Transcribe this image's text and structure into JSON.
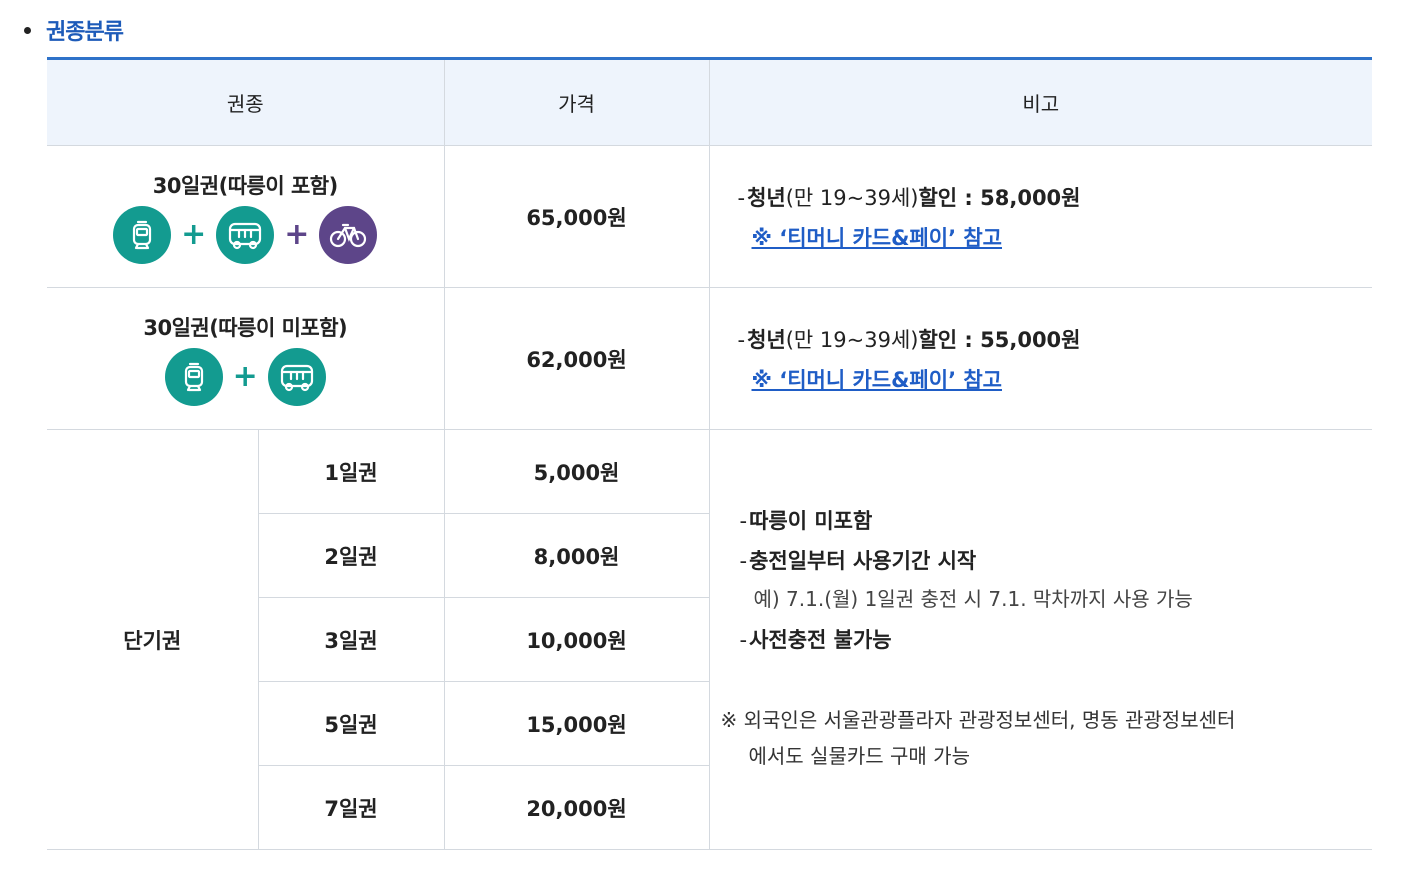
{
  "section": {
    "title": "권종분류"
  },
  "table": {
    "headers": [
      "권종",
      "가격",
      "비고"
    ],
    "monthly": [
      {
        "name": "30일권(따릉이 포함)",
        "icons": [
          "subway-icon",
          "bus-icon",
          "bicycle-icon"
        ],
        "price": "65,000원",
        "note_bold_a": "청년",
        "note_thin": "(만 19~39세)",
        "note_bold_b": "할인 : 58,000원",
        "note_link": "※ ‘티머니 카드&페이’ 참고"
      },
      {
        "name": "30일권(따릉이 미포함)",
        "icons": [
          "subway-icon",
          "bus-icon"
        ],
        "price": "62,000원",
        "note_bold_a": "청년",
        "note_thin": "(만 19~39세)",
        "note_bold_b": "할인 : 55,000원",
        "note_link": "※ ‘티머니 카드&페이’ 참고"
      }
    ],
    "short_term": {
      "label": "단기권",
      "rows": [
        {
          "name": "1일권",
          "price": "5,000원"
        },
        {
          "name": "2일권",
          "price": "8,000원"
        },
        {
          "name": "3일권",
          "price": "10,000원"
        },
        {
          "name": "5일권",
          "price": "15,000원"
        },
        {
          "name": "7일권",
          "price": "20,000원"
        }
      ],
      "notes": {
        "item1": "따릉이 미포함",
        "item2": "충전일부터 사용기간 시작",
        "item2_sub": "예) 7.1.(월) 1일권 충전 시 7.1. 막차까지 사용 가능",
        "item3": "사전충전 불가능",
        "foreign_line1": "※ 외국인은 서울관광플라자 관광정보센터, 명동 관광정보센터",
        "foreign_line2": "에서도 실물카드 구매 가능"
      }
    }
  },
  "colors": {
    "accent": "#2e72c9",
    "teal": "#139b90",
    "purple": "#5d4589",
    "link": "#1f5dc6"
  }
}
